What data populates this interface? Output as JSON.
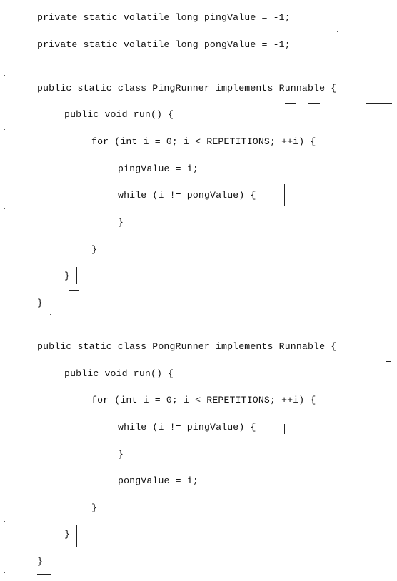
{
  "code": {
    "fields": [
      "private static volatile long pingValue = -1;",
      "private static volatile long pongValue = -1;"
    ],
    "ping_class": {
      "header": "public static class PingRunner implements Runnable {",
      "run_decl": "public void run() {",
      "for_loop": "for (int i = 0; i < REPETITIONS; ++i) {",
      "assign": "pingValue = i;",
      "while_loop": "while (i != pongValue) {",
      "while_close": "}",
      "for_close": "}",
      "run_close": "}",
      "class_close": "}"
    },
    "pong_class": {
      "header": "public static class PongRunner implements Runnable {",
      "run_decl": "public void run() {",
      "for_loop": "for (int i = 0; i < REPETITIONS; ++i) {",
      "while_loop": "while (i != pingValue) {",
      "while_close": "}",
      "assign": "pongValue = i;",
      "for_close": "}",
      "run_close": "}",
      "class_close": "}"
    }
  }
}
